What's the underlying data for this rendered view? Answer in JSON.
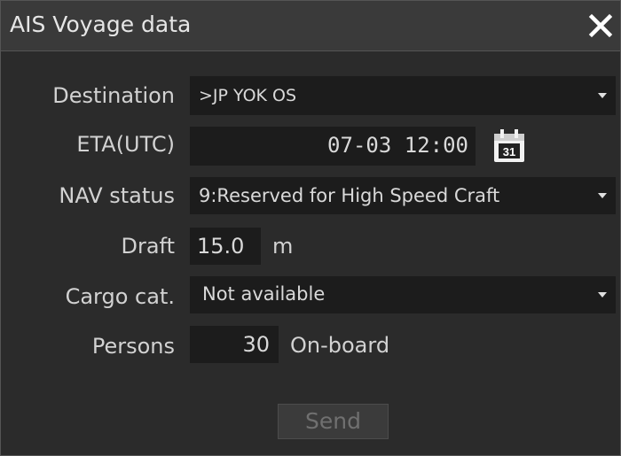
{
  "window": {
    "title": "AIS Voyage data",
    "close_icon": "close-icon"
  },
  "form": {
    "destination": {
      "label": "Destination",
      "value": ">JP YOK OS"
    },
    "eta": {
      "label": "ETA(UTC)",
      "value": "07-03 12:00",
      "calendar_day": "31"
    },
    "nav_status": {
      "label": "NAV status",
      "value": "9:Reserved for High Speed Craft"
    },
    "draft": {
      "label": "Draft",
      "value": "15.0",
      "unit": "m"
    },
    "cargo": {
      "label": "Cargo cat.",
      "value": "Not available"
    },
    "persons": {
      "label": "Persons",
      "value": "30",
      "suffix": "On-board"
    }
  },
  "actions": {
    "send_label": "Send"
  },
  "colors": {
    "background": "#2b2b2b",
    "field": "#1c1c1c",
    "text": "#d9d9d9",
    "titlebar": "#3a3a3a"
  }
}
